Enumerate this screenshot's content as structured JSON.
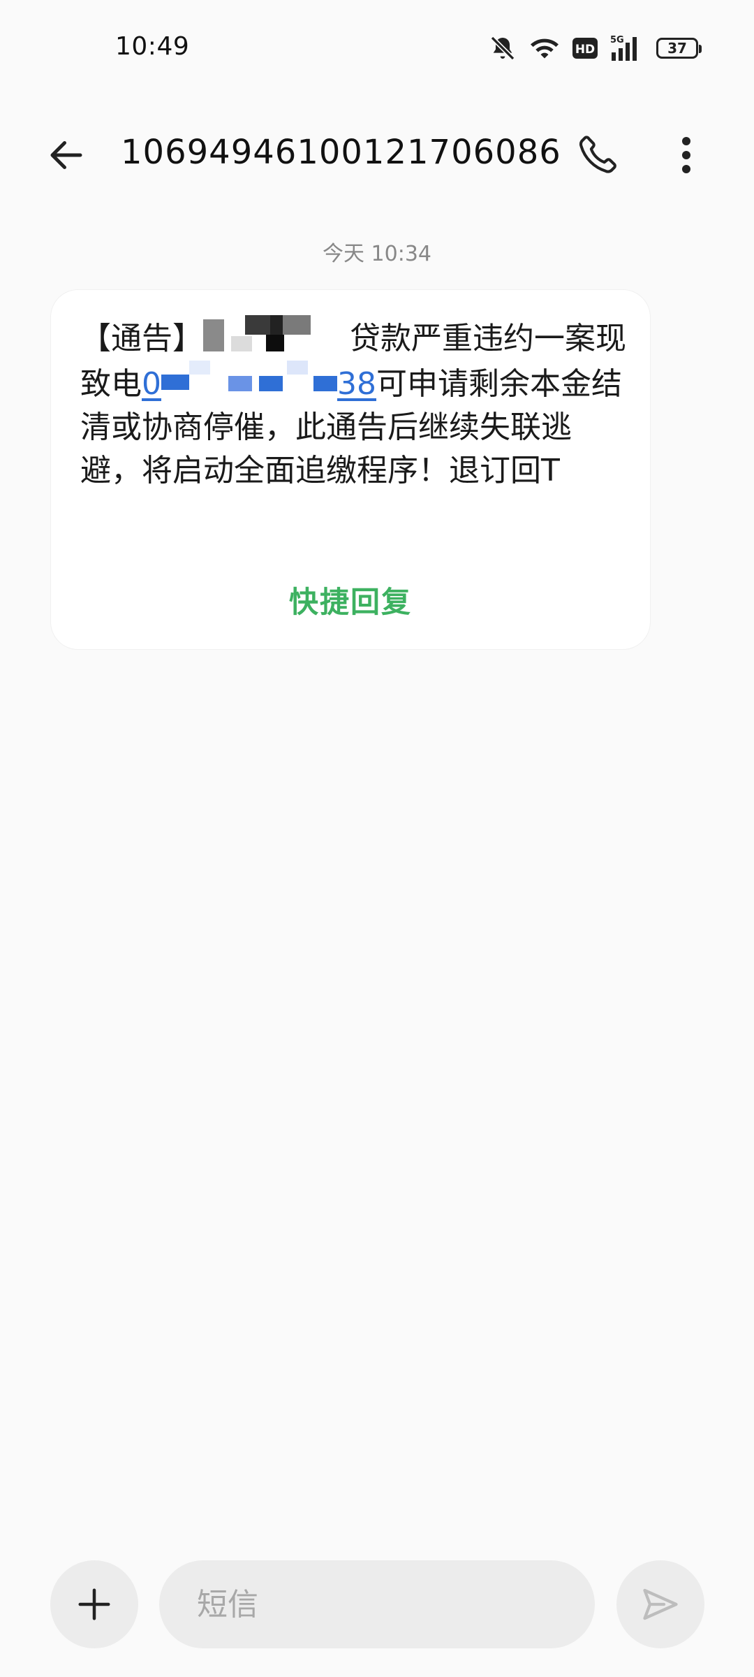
{
  "status_bar": {
    "time": "10:49",
    "network_type": "5G",
    "hd_label": "HD",
    "battery_level": "37",
    "icons": [
      "bell-off-icon",
      "wifi-icon",
      "hd-icon",
      "signal-icon",
      "battery-icon"
    ]
  },
  "header": {
    "back_icon": "arrow-left-icon",
    "title": "1069494610012170​6086",
    "call_icon": "phone-icon",
    "more_icon": "more-vertical-icon"
  },
  "conversation": {
    "date_label": "今天 10:34",
    "messages": [
      {
        "part1": "【通告】",
        "part2": "贷款严重违约一案现致电",
        "phone_prefix": "0",
        "phone_suffix": "38",
        "part3": "可申请剩余本金结清或协商停催，此通告后继续失联逃避，将启动全面追缴程序！退订回T",
        "quick_reply_label": "快捷回复"
      }
    ]
  },
  "composer": {
    "add_icon": "plus-icon",
    "placeholder": "短信",
    "send_icon": "send-icon"
  },
  "colors": {
    "background": "#fafafa",
    "bubble": "#ffffff",
    "accent_green": "#3db160",
    "link_blue": "#2f6fd6",
    "control_gray": "#ececec"
  }
}
